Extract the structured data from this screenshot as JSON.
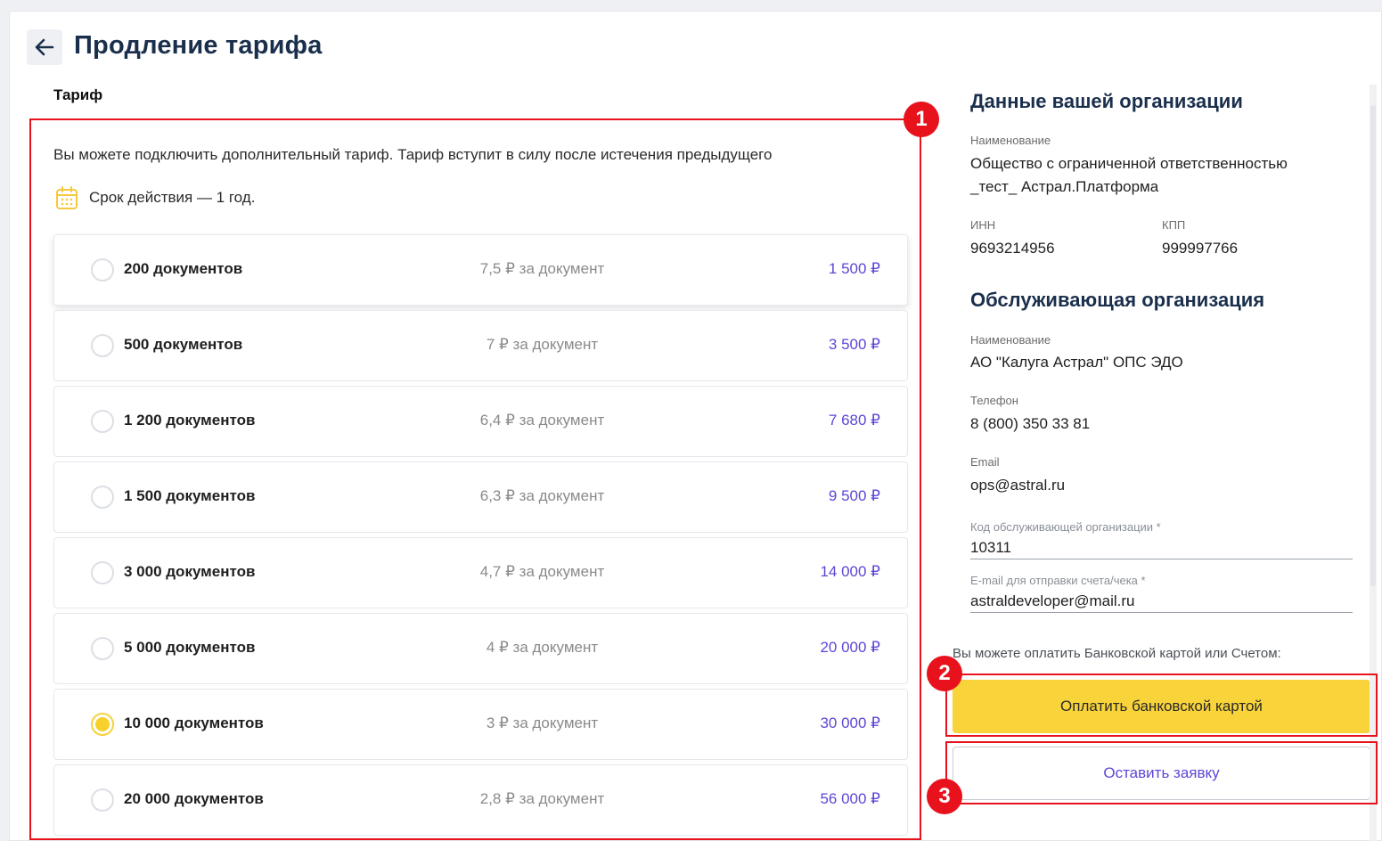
{
  "header": {
    "title": "Продление тарифа",
    "back_icon": "arrow-left-icon"
  },
  "tariff": {
    "section_label": "Тариф",
    "info": "Вы можете подключить дополнительный тариф. Тариф вступит в силу после истечения предыдущего",
    "validity": "Срок действия — 1 год.",
    "rows": [
      {
        "docs": "200 документов",
        "unit": "7,5 ₽ за документ",
        "price": "1 500 ₽",
        "selected": false
      },
      {
        "docs": "500 документов",
        "unit": "7 ₽ за документ",
        "price": "3 500 ₽",
        "selected": false
      },
      {
        "docs": "1 200 документов",
        "unit": "6,4 ₽ за документ",
        "price": "7 680 ₽",
        "selected": false
      },
      {
        "docs": "1 500 документов",
        "unit": "6,3 ₽ за документ",
        "price": "9 500 ₽",
        "selected": false
      },
      {
        "docs": "3 000 документов",
        "unit": "4,7 ₽ за документ",
        "price": "14 000 ₽",
        "selected": false
      },
      {
        "docs": "5 000 документов",
        "unit": "4 ₽ за документ",
        "price": "20 000 ₽",
        "selected": false
      },
      {
        "docs": "10 000 документов",
        "unit": "3 ₽ за документ",
        "price": "30 000 ₽",
        "selected": true
      },
      {
        "docs": "20 000 документов",
        "unit": "2,8 ₽ за документ",
        "price": "56 000 ₽",
        "selected": false
      }
    ]
  },
  "org": {
    "title": "Данные вашей организации",
    "name_label": "Наименование",
    "name_line1": "Общество с ограниченной ответственностью",
    "name_line2": "_тест_ Астрал.Платформа",
    "inn_label": "ИНН",
    "inn": "9693214956",
    "kpp_label": "КПП",
    "kpp": "999997766"
  },
  "service": {
    "title": "Обслуживающая организация",
    "name_label": "Наименование",
    "name": "АО \"Калуга Астрал\" ОПС ЭДО",
    "phone_label": "Телефон",
    "phone": "8 (800) 350 33 81",
    "email_label": "Email",
    "email": "ops@astral.ru",
    "code_label": "Код обслуживающей организации *",
    "code": "10311",
    "invoice_email_label": "E-mail для отправки счета/чека *",
    "invoice_email": "astraldeveloper@mail.ru"
  },
  "payment": {
    "hint": "Вы можете оплатить Банковской картой или Счетом:",
    "card_button": "Оплатить банковской картой",
    "request_button": "Оставить заявку"
  },
  "annotations": [
    "1",
    "2",
    "3"
  ],
  "colors": {
    "accent": "#f8d33a",
    "price": "#5b47d6",
    "annotation": "#e8121d",
    "title": "#1a2f4c"
  }
}
